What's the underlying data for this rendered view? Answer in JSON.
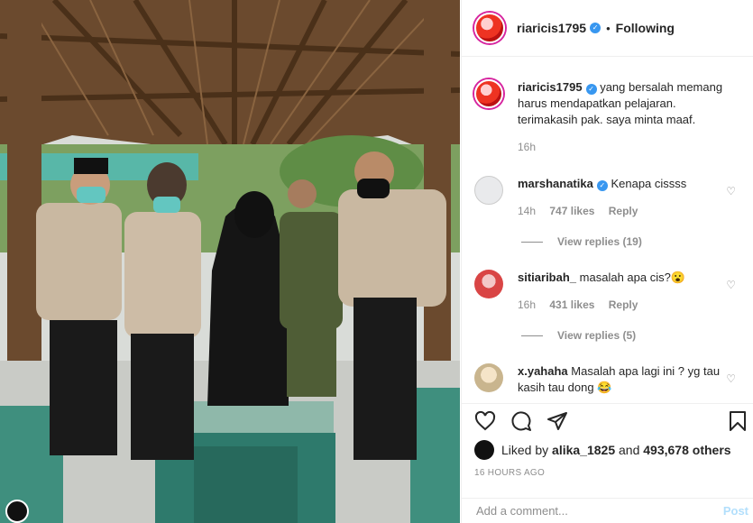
{
  "header": {
    "username": "riaricis1795",
    "separator": "•",
    "follow_status": "Following"
  },
  "caption": {
    "username": "riaricis1795",
    "text": "yang bersalah memang harus mendapatkan pelajaran. terimakasih pak. saya minta maaf.",
    "time": "16h"
  },
  "comments": [
    {
      "username": "marshanatika",
      "verified": true,
      "text": "Kenapa cissss",
      "time": "14h",
      "likes": "747 likes",
      "reply": "Reply",
      "view_replies": "View replies (19)"
    },
    {
      "username": "sitiaribah_",
      "verified": false,
      "text": "masalah apa cis?😮",
      "time": "16h",
      "likes": "431 likes",
      "reply": "Reply",
      "view_replies": "View replies (5)"
    },
    {
      "username": "x.yahaha",
      "verified": false,
      "text": "Masalah apa lagi ini ? yg tau kasih tau dong 😂",
      "time": "",
      "likes": "",
      "reply": "",
      "view_replies": ""
    }
  ],
  "liked_by": {
    "prefix": "Liked by ",
    "user": "alika_1825",
    "middle": " and ",
    "others": "493,678 others"
  },
  "timestamp": "16 HOURS AGO",
  "add_comment": {
    "placeholder": "Add a comment...",
    "post_label": "Post"
  },
  "icons": [
    "heart-icon",
    "comment-icon",
    "share-icon",
    "save-icon",
    "verified-icon"
  ],
  "colors": {
    "verified": "#3897f0",
    "post_disabled": "#b2dffc",
    "muted": "#8e8e8e"
  }
}
